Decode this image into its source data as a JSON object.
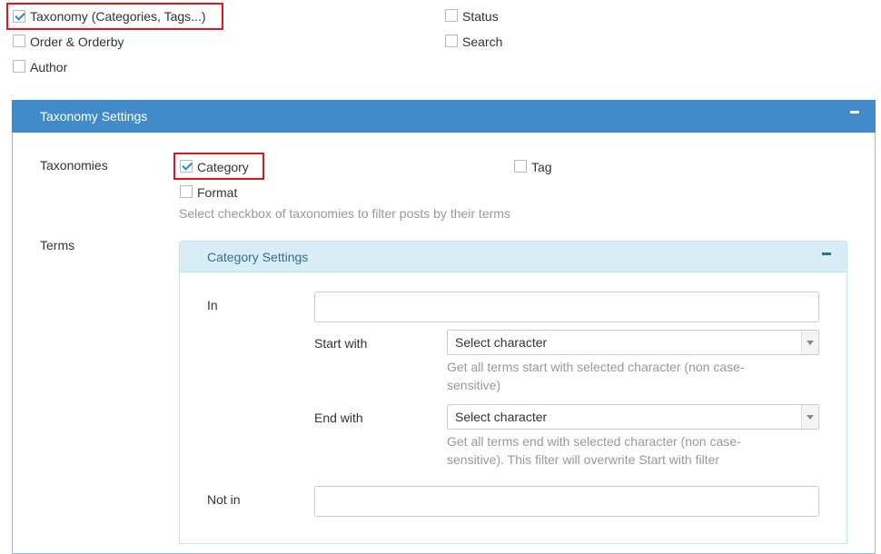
{
  "filters": {
    "taxonomy": {
      "label": "Taxonomy (Categories, Tags...)",
      "checked": true
    },
    "status": {
      "label": "Status",
      "checked": false
    },
    "order": {
      "label": "Order & Orderby",
      "checked": false
    },
    "search": {
      "label": "Search",
      "checked": false
    },
    "author": {
      "label": "Author",
      "checked": false
    }
  },
  "taxonomy_panel": {
    "title": "Taxonomy Settings",
    "taxonomies_label": "Taxonomies",
    "options": {
      "category": {
        "label": "Category",
        "checked": true
      },
      "tag": {
        "label": "Tag",
        "checked": false
      },
      "format": {
        "label": "Format",
        "checked": false
      }
    },
    "help": "Select checkbox of taxonomies to filter posts by their terms",
    "terms_label": "Terms"
  },
  "category_panel": {
    "title": "Category Settings",
    "in_label": "In",
    "in_value": "",
    "start_with_label": "Start with",
    "start_with_value": "Select character",
    "start_help_line1": "Get all terms start with selected character (non case-",
    "start_help_line2": "sensitive)",
    "end_with_label": "End with",
    "end_with_value": "Select character",
    "end_help_line1": "Get all terms end with selected character (non case-",
    "end_help_line2": "sensitive). This filter will overwrite Start with filter",
    "not_in_label": "Not in",
    "not_in_value": ""
  },
  "colors": {
    "panel_header": "#428bca",
    "sub_header": "#d9edf7",
    "highlight": "#e0151d",
    "check": "#1e8cbe"
  },
  "icons": {
    "collapse": "minus-icon",
    "dropdown": "chevron-down-icon"
  }
}
